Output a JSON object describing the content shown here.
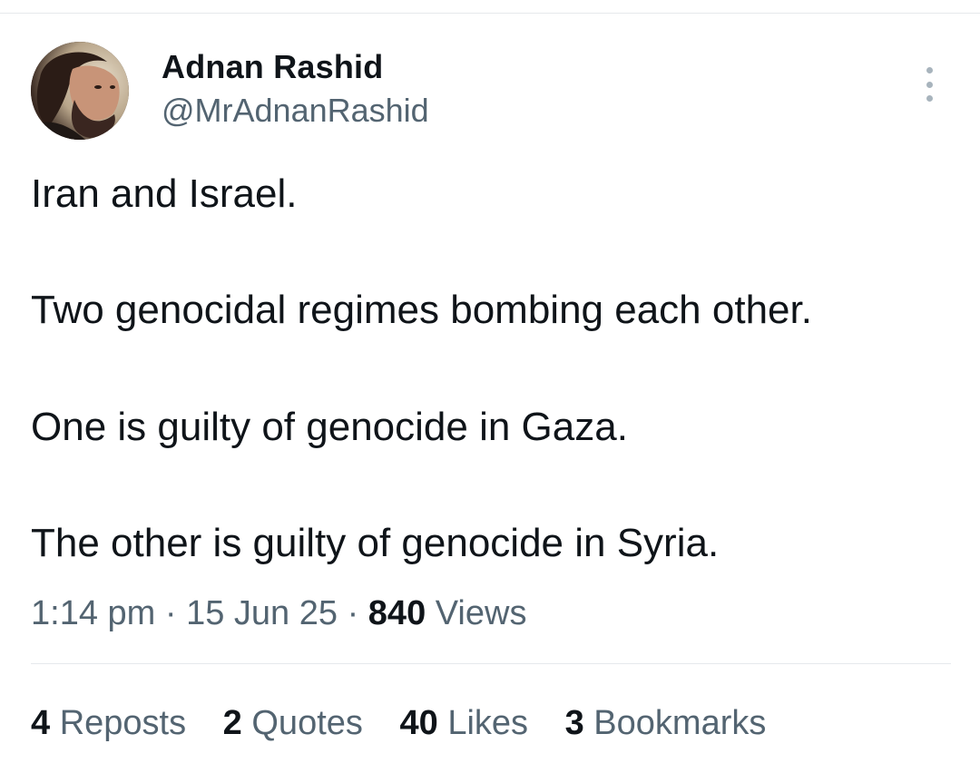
{
  "author": {
    "display_name": "Adnan Rashid",
    "handle": "@MrAdnanRashid"
  },
  "tweet": {
    "lines": [
      "Iran and Israel.",
      "Two genocidal regimes bombing each other.",
      "One is guilty of genocide in Gaza.",
      "The other is guilty of genocide in Syria."
    ]
  },
  "meta": {
    "time": "1:14 pm",
    "separator": "·",
    "date": "15 Jun 25",
    "views_count": "840",
    "views_label": "Views"
  },
  "stats": {
    "reposts": {
      "count": "4",
      "label": "Reposts"
    },
    "quotes": {
      "count": "2",
      "label": "Quotes"
    },
    "likes": {
      "count": "40",
      "label": "Likes"
    },
    "bookmarks": {
      "count": "3",
      "label": "Bookmarks"
    }
  },
  "icons": {
    "more": "more-horizontal-dots-icon"
  },
  "colors": {
    "text_primary": "#0f1419",
    "text_secondary": "#536471",
    "divider": "#e6e9ec",
    "more_icon": "#a8b4bd"
  }
}
